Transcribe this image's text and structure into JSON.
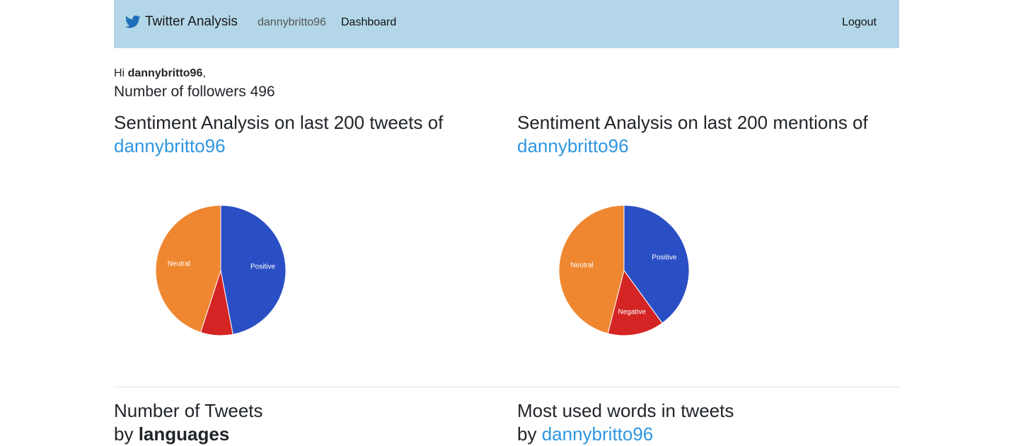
{
  "navbar": {
    "brand": "Twitter Analysis",
    "username": "dannybritto96",
    "dashboard": "Dashboard",
    "logout": "Logout",
    "icon": "twitter-bird-icon"
  },
  "greeting": {
    "hi": "Hi",
    "username": "dannybritto96",
    "comma": ",",
    "followers_label": "Number of followers",
    "followers_count": "496"
  },
  "tweets_section": {
    "title": "Sentiment Analysis on last 200 tweets of",
    "user": "dannybritto96"
  },
  "mentions_section": {
    "title": "Sentiment Analysis on last 200 mentions of",
    "user": "dannybritto96"
  },
  "languages_section": {
    "line1": "Number of Tweets",
    "by": "by",
    "bold": "languages"
  },
  "words_section": {
    "line1": "Most used words in tweets",
    "by": "by",
    "user": "dannybritto96"
  },
  "colors": {
    "positive": "#2a4fc5",
    "negative": "#d42424",
    "neutral": "#ee8730",
    "navbar": "#b3d7e9",
    "link": "#2f96e0"
  },
  "chart_data": [
    {
      "type": "pie",
      "categories": [
        "Positive",
        "Negative",
        "Neutral"
      ],
      "values": [
        47,
        8,
        45
      ],
      "shown_labels": [
        "Positive",
        "",
        "Neutral"
      ]
    },
    {
      "type": "pie",
      "categories": [
        "Positive",
        "Negative",
        "Neutral"
      ],
      "values": [
        40,
        14,
        46
      ],
      "shown_labels": [
        "Positive",
        "Negative",
        "Neutral"
      ]
    }
  ]
}
